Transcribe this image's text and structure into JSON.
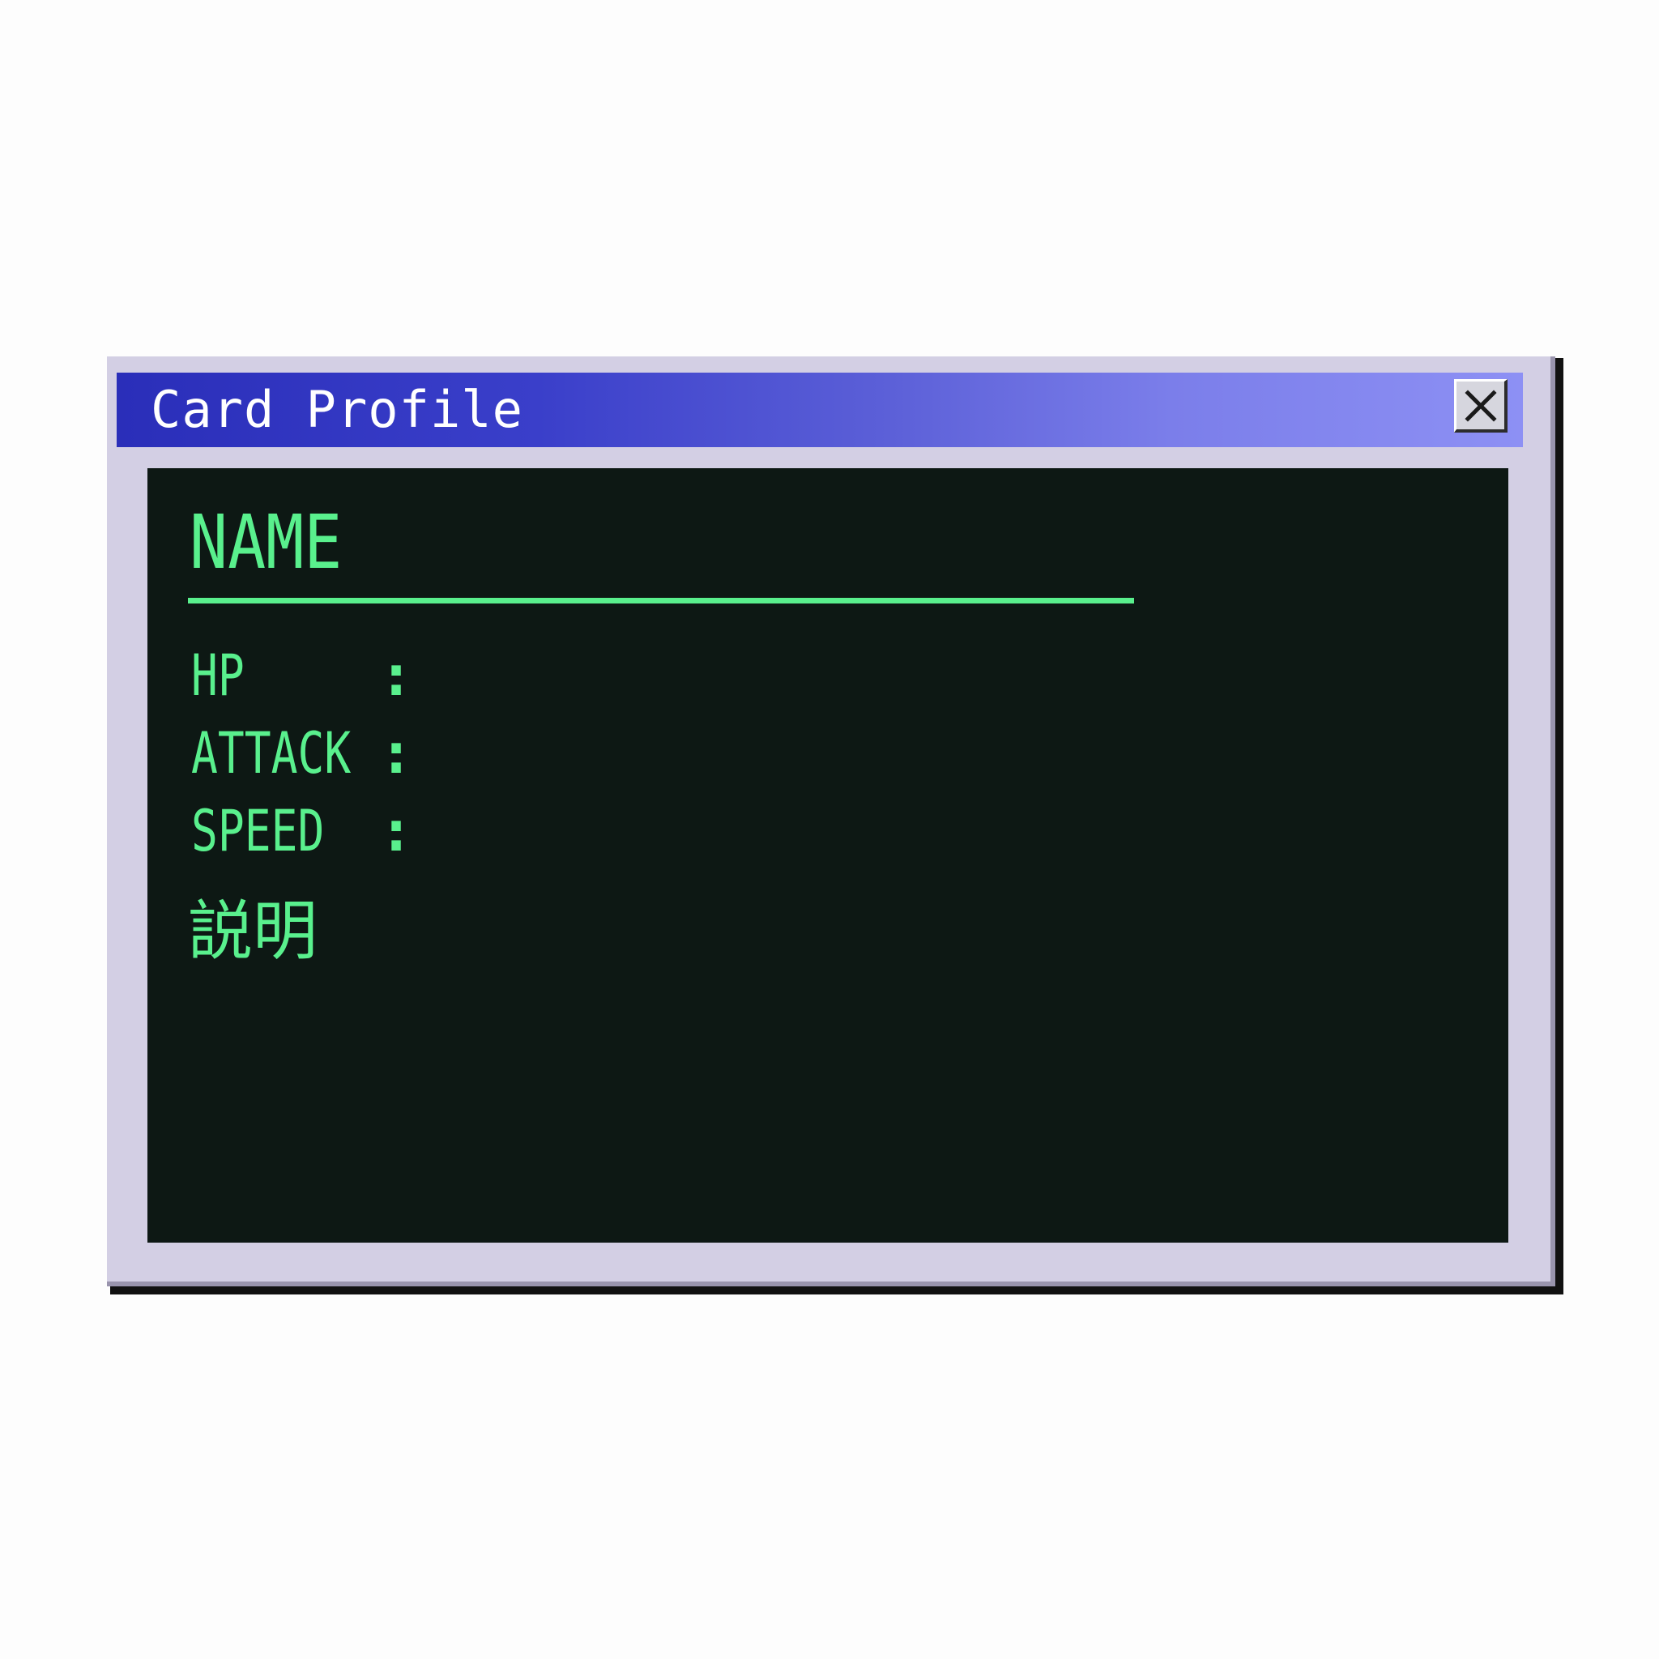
{
  "window": {
    "title": "Card Profile",
    "close_icon": "close-icon"
  },
  "card": {
    "name_heading": "NAME",
    "stats": [
      {
        "label": "HP",
        "separator": ":"
      },
      {
        "label": "ATTACK",
        "separator": ":"
      },
      {
        "label": "SPEED",
        "separator": ":"
      }
    ],
    "description_label": "説明"
  },
  "colors": {
    "titlebar_start": "#2a2eb9",
    "titlebar_end": "#8d90f4",
    "window_body": "#d3cfe4",
    "screen_background": "#0d1814",
    "terminal_text": "#59f08d"
  }
}
